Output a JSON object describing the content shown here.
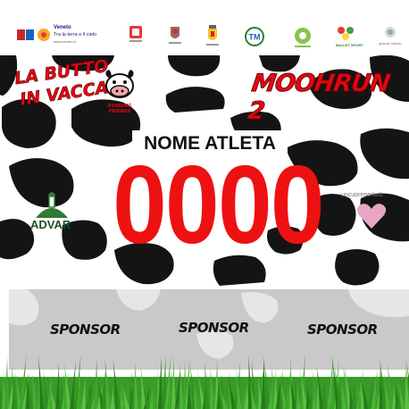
{
  "top_logos": {
    "veneto_title": "Veneto",
    "veneto_tagline": "Tra la terra e il cielo",
    "veneto_url": "www.veneto.it",
    "tm_text": "TM",
    "ballet_text": "BALLET SPORT",
    "right_text": "grande fratello"
  },
  "event": {
    "left_title_line1": "LA BUTTO",
    "left_title_line2": "IN VACCA",
    "left_subtitle": "RUNNING FRIENDS",
    "title": "MOOHRUN 2"
  },
  "athlete": {
    "name_label": "NOME ATLETA",
    "bib_number": "0000"
  },
  "partners": {
    "advar": "ADVAR",
    "uncuore": "uncuorepertutti"
  },
  "sponsors": [
    "SPONSOR",
    "SPONSOR",
    "SPONSOR"
  ],
  "colors": {
    "accent_red": "#e30613",
    "number_red": "#ee1111",
    "sponsor_band": "#c9c9c9",
    "grass_green": "#3fa52b"
  }
}
